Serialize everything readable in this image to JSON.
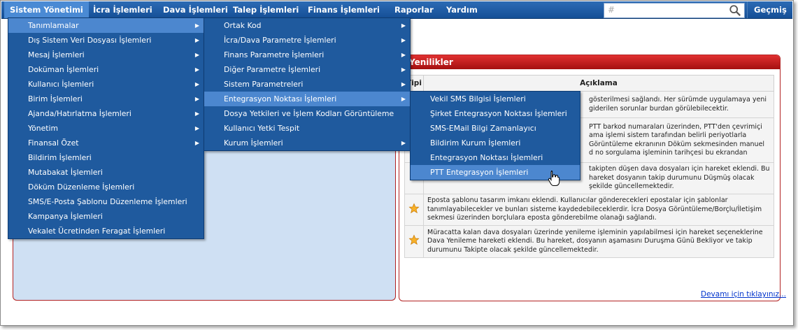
{
  "menubar": {
    "items": [
      {
        "label": "Sistem Yönetimi"
      },
      {
        "label": "İcra İşlemleri"
      },
      {
        "label": "Dava İşlemleri"
      },
      {
        "label": "Talep İşlemleri"
      },
      {
        "label": "Finans İşlemleri"
      },
      {
        "label": "Raporlar"
      },
      {
        "label": "Yardım"
      }
    ],
    "search_value": "#",
    "history_label": "Geçmiş"
  },
  "menu_level1": [
    {
      "label": "Tanımlamalar",
      "submenu": true
    },
    {
      "label": "Dış Sistem Veri Dosyası İşlemleri",
      "submenu": true
    },
    {
      "label": "Mesaj İşlemleri",
      "submenu": true
    },
    {
      "label": "Doküman İşlemleri",
      "submenu": true
    },
    {
      "label": "Kullanıcı İşlemleri",
      "submenu": true
    },
    {
      "label": "Birim İşlemleri",
      "submenu": true
    },
    {
      "label": "Ajanda/Hatırlatma İşlemleri",
      "submenu": true
    },
    {
      "label": "Yönetim",
      "submenu": true
    },
    {
      "label": "Finansal Özet",
      "submenu": true
    },
    {
      "label": "Bildirim İşlemleri",
      "submenu": false
    },
    {
      "label": "Mutabakat İşlemleri",
      "submenu": false
    },
    {
      "label": "Döküm Düzenleme İşlemleri",
      "submenu": false
    },
    {
      "label": "SMS/E-Posta Şablonu Düzenleme İşlemleri",
      "submenu": false
    },
    {
      "label": "Kampanya İşlemleri",
      "submenu": false
    },
    {
      "label": "Vekalet Ücretinden Feragat İşlemleri",
      "submenu": false
    }
  ],
  "menu_level2": [
    {
      "label": "Ortak Kod",
      "submenu": true
    },
    {
      "label": "İcra/Dava Parametre İşlemleri",
      "submenu": true
    },
    {
      "label": "Finans Parametre İşlemleri",
      "submenu": true
    },
    {
      "label": "Diğer Parametre İşlemleri",
      "submenu": true
    },
    {
      "label": "Sistem Parametreleri",
      "submenu": true
    },
    {
      "label": "Entegrasyon Noktası İşlemleri",
      "submenu": true
    },
    {
      "label": "Dosya Yetkileri ve İşlem Kodları Görüntüleme",
      "submenu": false
    },
    {
      "label": "Kullanıcı Yetki Tespit",
      "submenu": false
    },
    {
      "label": "Kurum İşlemleri",
      "submenu": true
    }
  ],
  "menu_level3": [
    {
      "label": "Vekil SMS Bilgisi İşlemleri"
    },
    {
      "label": "Şirket Entegrasyon Noktası İşlemleri"
    },
    {
      "label": "SMS-EMail Bilgi Zamanlayıcı"
    },
    {
      "label": "Bildirim Kurum İşlemleri"
    },
    {
      "label": "Entegrasyon Noktası İşlemleri"
    },
    {
      "label": "PTT Entegrasyon İşlemleri"
    }
  ],
  "news_panel": {
    "title": "Yenilikler",
    "col_type": "Tipi",
    "col_desc": "Açıklama",
    "rows": [
      {
        "text": "gösterilmesi sağlandı. Her sürümde uygulamaya yeni giderilen sorunlar burdan görülebilecektir."
      },
      {
        "text": "PTT barkod numaraları üzerinden, PTT'den çevrimiçi ama işlemi sistem tarafından belirli periyotlarla Görüntüleme ekranının Döküm sekmesinden manuel d no sorgulama işleminin tarihçesi bu ekrandan"
      },
      {
        "text": "takipten düşen dava dosyaları için hareket eklendi. Bu hareket dosyanın takip durumunu Düşmüş olacak şekilde güncellemektedir."
      },
      {
        "text": "Eposta şablonu tasarım imkanı eklendi. Kullanıcılar gönderecekleri epostalar için şablonlar tanımlayabilecekler ve bunları sisteme kaydedebileceklerdir. İcra Dosya Görüntüleme/Borçlu/İletişim sekmesi üzerinden borçlulara eposta gönderebilme olanağı sağlandı."
      },
      {
        "text": "Müracatta kalan dava dosyaları üzerinde yenileme işleminin yapılabilmesi için hareket seçeneklerine Dava Yenileme hareketi eklendi. Bu hareket, dosyanın aşamasını Duruşma Günü Bekliyor ve takip durumunu Takipte olacak şekilde güncellemektedir."
      }
    ],
    "more_link": "Devamı için tıklayınız..."
  },
  "colors": {
    "menubar": "#1a559c",
    "menu_bg": "#1f5a9e",
    "menu_highlight": "#4c87cf",
    "panel_header": "#c01818",
    "star": "#f5a623"
  }
}
